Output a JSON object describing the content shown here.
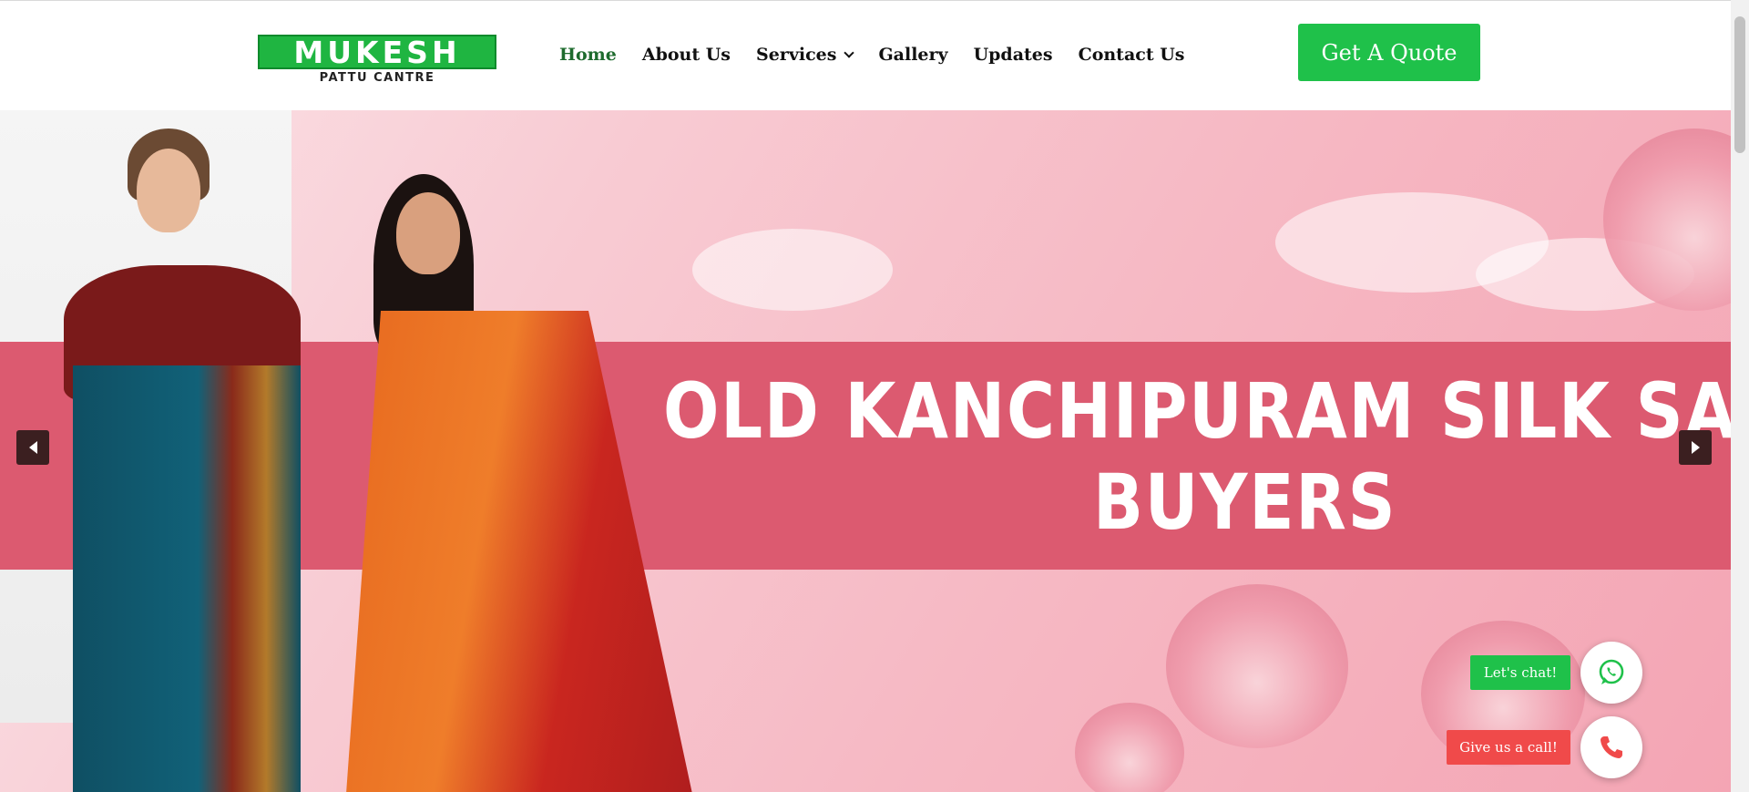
{
  "logo": {
    "name": "MUKESH",
    "tagline": "PATTU CANTRE"
  },
  "nav": {
    "items": [
      {
        "label": "Home",
        "active": true
      },
      {
        "label": "About Us",
        "active": false
      },
      {
        "label": "Services",
        "active": false,
        "has_dropdown": true
      },
      {
        "label": "Gallery",
        "active": false
      },
      {
        "label": "Updates",
        "active": false
      },
      {
        "label": "Contact Us",
        "active": false
      }
    ]
  },
  "quote_button": {
    "label": "Get A Quote"
  },
  "hero": {
    "headline_line1": "OLD KANCHIPURAM SILK SAR",
    "headline_line2": "BUYERS"
  },
  "widgets": {
    "chat_label": "Let's chat!",
    "call_label": "Give us a call!"
  },
  "colors": {
    "brand_green": "#1fc14a",
    "nav_active": "#1e6b2e",
    "banner": "#dc5a70",
    "call_red": "#f04a4a",
    "slider_arrow": "#3b1f20"
  }
}
